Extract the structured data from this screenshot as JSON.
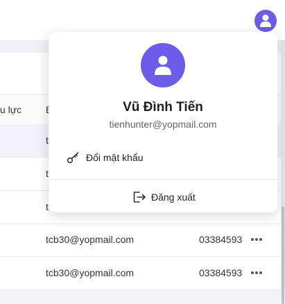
{
  "colors": {
    "accent": "#6c5ce7"
  },
  "header": {
    "avatar_icon": "user-avatar-icon"
  },
  "table": {
    "headers": [
      "u lực",
      "E"
    ],
    "rows": [
      {
        "left": "",
        "email": "t",
        "phone": ""
      },
      {
        "left": "",
        "email": "t",
        "phone": ""
      },
      {
        "left": "",
        "email": "t",
        "phone": ""
      },
      {
        "left": "",
        "email": "tcb30@yopmail.com",
        "phone": "03384593"
      },
      {
        "left": "",
        "email": "tcb30@yopmail.com",
        "phone": "03384593"
      }
    ]
  },
  "dropdown": {
    "avatar_icon": "user-avatar-icon",
    "name": "Vũ Đình Tiến",
    "email": "tienhunter@yopmail.com",
    "change_password": {
      "label": "Đổi mật khẩu",
      "icon": "key-icon"
    },
    "logout": {
      "label": "Đăng xuất",
      "icon": "logout-icon"
    }
  }
}
